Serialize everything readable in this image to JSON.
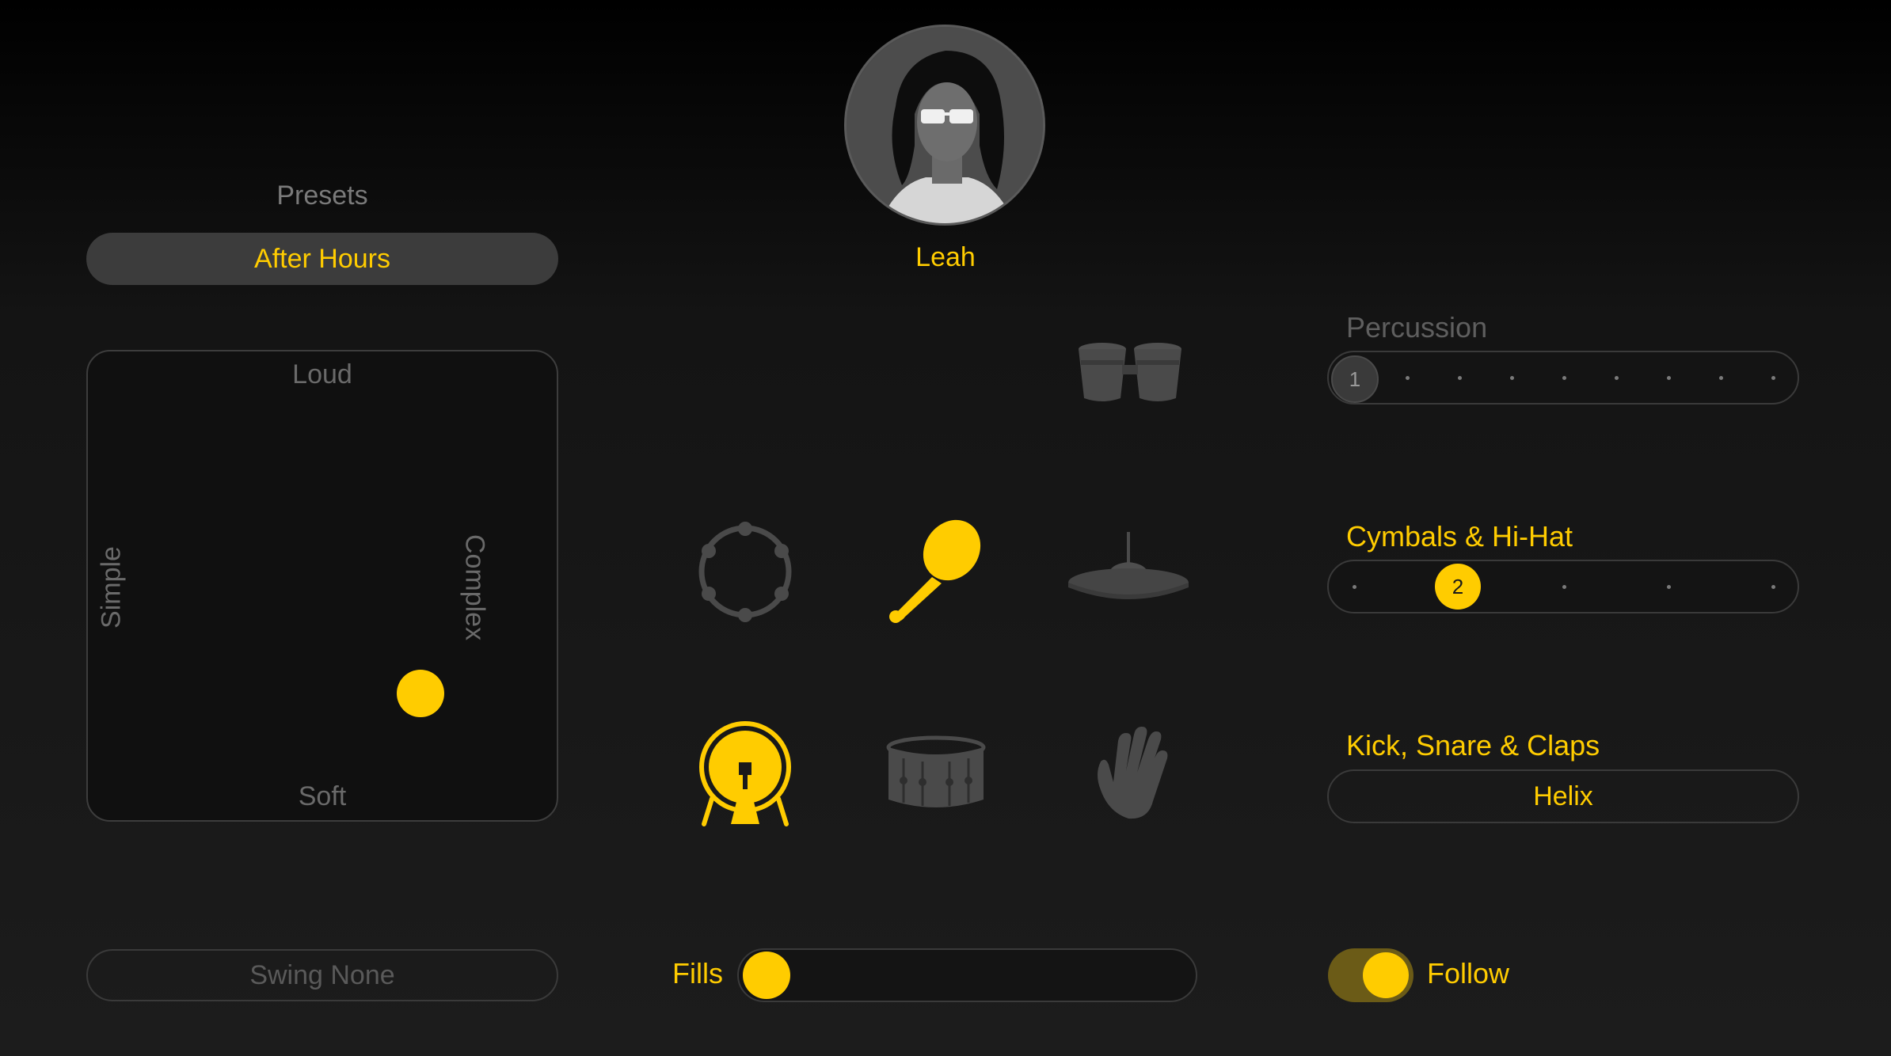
{
  "colors": {
    "accent": "#ffcc00",
    "inactive": "#5f5f5f",
    "background": "#1c1c1c"
  },
  "presets": {
    "label": "Presets",
    "selected": "After Hours"
  },
  "xy_pad": {
    "top": "Loud",
    "bottom": "Soft",
    "left": "Simple",
    "right": "Complex",
    "complexity": 0.71,
    "loudness": 0.25
  },
  "swing": {
    "label": "Swing None"
  },
  "drummer": {
    "name": "Leah"
  },
  "instruments": [
    {
      "name": "bongos",
      "active": false
    },
    {
      "name": "tambourine",
      "active": false
    },
    {
      "name": "maraca",
      "active": true
    },
    {
      "name": "cymbal",
      "active": false
    },
    {
      "name": "kick-drum",
      "active": true
    },
    {
      "name": "snare-drum",
      "active": false
    },
    {
      "name": "hand-clap",
      "active": false
    }
  ],
  "percussion": {
    "label": "Percussion",
    "value": "1",
    "steps": 9
  },
  "cymbals": {
    "label": "Cymbals & Hi-Hat",
    "value": "2",
    "steps": 5
  },
  "kick_snare": {
    "label": "Kick, Snare & Claps",
    "pattern": "Helix"
  },
  "fills": {
    "label": "Fills",
    "value": 0.0
  },
  "follow": {
    "label": "Follow",
    "on": true
  }
}
